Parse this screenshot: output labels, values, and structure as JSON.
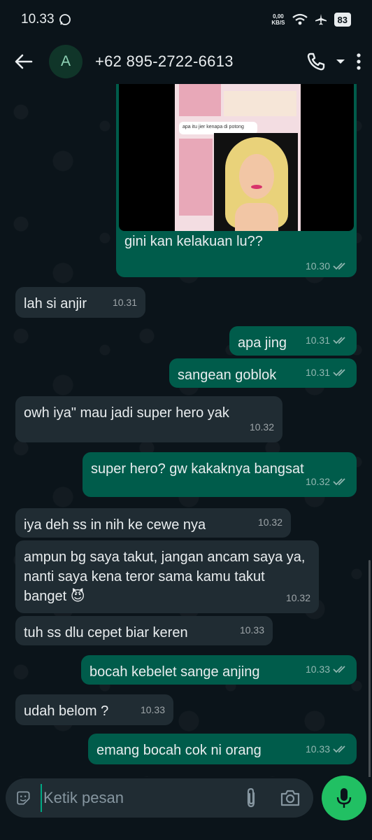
{
  "status_bar": {
    "time": "10.33",
    "net_speed_value": "0,00",
    "net_speed_unit": "KB/S",
    "battery": "83"
  },
  "header": {
    "avatar_letter": "A",
    "contact": "+62 895-2722-6613"
  },
  "image_message": {
    "caption": "gini kan kelakuan lu??",
    "time": "10.30",
    "inner_text": "apa itu jier kenapa di potong"
  },
  "messages": [
    {
      "dir": "in",
      "text": "lah si anjir",
      "time": "10.31"
    },
    {
      "dir": "out",
      "text": "apa jing",
      "time": "10.31"
    },
    {
      "dir": "out",
      "text": "sangean goblok",
      "time": "10.31"
    },
    {
      "dir": "in",
      "text": "owh iya\" mau jadi super hero yak",
      "time": "10.32"
    },
    {
      "dir": "out",
      "text": "super hero? gw kakaknya bangsat",
      "time": "10.32"
    },
    {
      "dir": "in",
      "text": "iya deh ss in nih ke cewe nya",
      "time": "10.32"
    },
    {
      "dir": "in",
      "text": "ampun bg saya takut, jangan ancam saya ya, nanti saya kena teror sama kamu takut banget 😈",
      "time": "10.32"
    },
    {
      "dir": "in",
      "text": "tuh ss dlu cepet biar keren",
      "time": "10.33"
    },
    {
      "dir": "out",
      "text": "bocah kebelet sange anjing",
      "time": "10.33"
    },
    {
      "dir": "in",
      "text": "udah belom ?",
      "time": "10.33"
    },
    {
      "dir": "out",
      "text": "emang bocah cok ni orang",
      "time": "10.33"
    }
  ],
  "composer": {
    "placeholder": "Ketik pesan"
  },
  "colors": {
    "background": "#0b141a",
    "incoming": "#202c33",
    "outgoing": "#005c4b",
    "accent": "#21c063"
  }
}
